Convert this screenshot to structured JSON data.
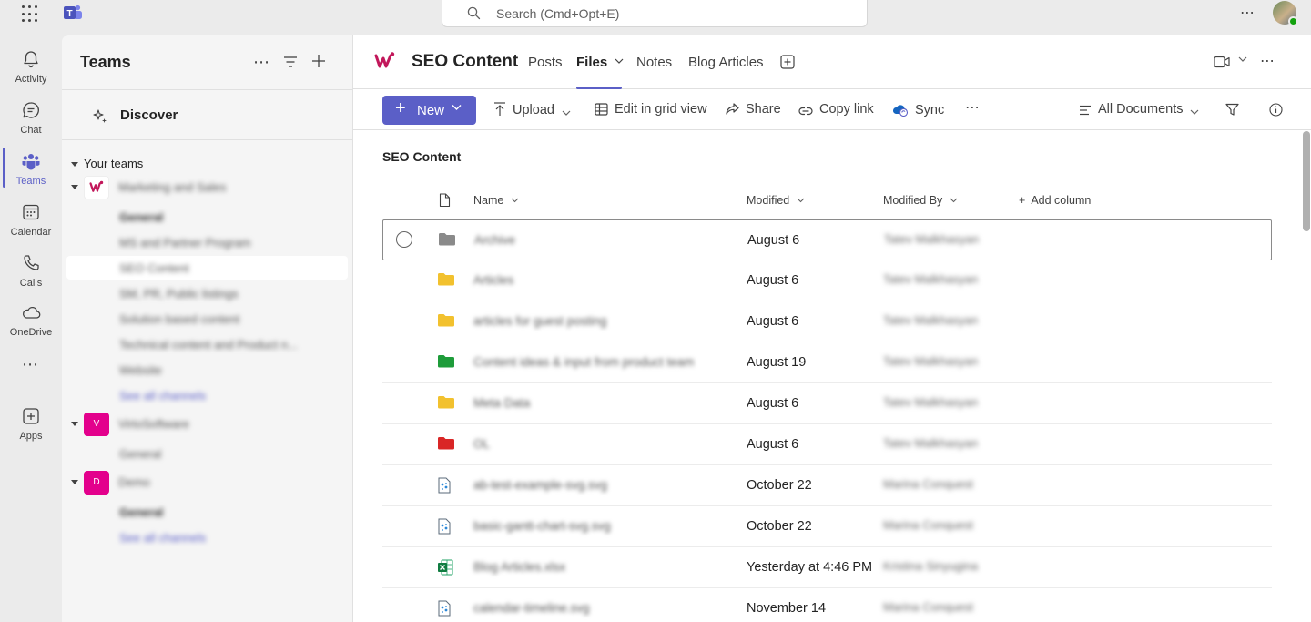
{
  "titlebar": {
    "search_placeholder": "Search (Cmd+Opt+E)"
  },
  "rail": {
    "items": [
      {
        "label": "Activity",
        "icon": "bell-icon"
      },
      {
        "label": "Chat",
        "icon": "chat-icon"
      },
      {
        "label": "Teams",
        "icon": "teams-icon"
      },
      {
        "label": "Calendar",
        "icon": "calendar-icon"
      },
      {
        "label": "Calls",
        "icon": "phone-icon"
      },
      {
        "label": "OneDrive",
        "icon": "cloud-icon"
      },
      {
        "label": "Apps",
        "icon": "add-app-icon"
      }
    ]
  },
  "pane": {
    "title": "Teams",
    "discover": "Discover",
    "section": "Your teams",
    "teams": [
      {
        "name": "Marketing and Sales",
        "tile": ""
      },
      {
        "name": "VirtoSoftware",
        "tile": "V"
      },
      {
        "name": "Demo",
        "tile": "D"
      }
    ],
    "channels": [
      "General",
      "MS and Partner Program",
      "SEO Content",
      "SM, PR, Public listings",
      "Solution based content",
      "Technical content and Product n...",
      "Website",
      "See all channels",
      "General",
      "General",
      "See all channels"
    ]
  },
  "header": {
    "channel_title": "SEO Content",
    "tabs": [
      "Posts",
      "Files",
      "Notes",
      "Blog Articles"
    ]
  },
  "toolbar": {
    "new": "New",
    "upload": "Upload",
    "grid": "Edit in grid view",
    "share": "Share",
    "copy_link": "Copy link",
    "sync": "Sync",
    "view": "All Documents"
  },
  "library": {
    "title": "SEO Content",
    "columns": {
      "name": "Name",
      "modified": "Modified",
      "modified_by": "Modified By",
      "add": "Add column"
    },
    "rows": [
      {
        "name": "Archive",
        "modified": "August 6",
        "by": "Tatev Malkhasyan",
        "type": "folder-gray"
      },
      {
        "name": "Articles",
        "modified": "August 6",
        "by": "Tatev Malkhasyan",
        "type": "folder-yellow"
      },
      {
        "name": "articles for guest posting",
        "modified": "August 6",
        "by": "Tatev Malkhasyan",
        "type": "folder-yellow"
      },
      {
        "name": "Content ideas & input from product team",
        "modified": "August 19",
        "by": "Tatev Malkhasyan",
        "type": "folder-green"
      },
      {
        "name": "Meta Data",
        "modified": "August 6",
        "by": "Tatev Malkhasyan",
        "type": "folder-yellow"
      },
      {
        "name": "OL",
        "modified": "August 6",
        "by": "Tatev Malkhasyan",
        "type": "folder-red"
      },
      {
        "name": "ab-test-example-svg.svg",
        "modified": "October 22",
        "by": "Marina Conquest",
        "type": "svg"
      },
      {
        "name": "basic-gantt-chart-svg.svg",
        "modified": "October 22",
        "by": "Marina Conquest",
        "type": "svg"
      },
      {
        "name": "Blog Articles.xlsx",
        "modified": "Yesterday at 4:46 PM",
        "by": "Kristina Sinyugina",
        "type": "xlsx"
      },
      {
        "name": "calendar-timeline.svg",
        "modified": "November 14",
        "by": "Marina Conquest",
        "type": "svg"
      }
    ]
  },
  "colors": {
    "accent": "#5b5fc7",
    "folder_gray": "#8a8a8a",
    "folder_yellow": "#f2c12e",
    "folder_green": "#1e9c3a",
    "folder_red": "#d92626",
    "tile_pink": "#e3008c"
  }
}
